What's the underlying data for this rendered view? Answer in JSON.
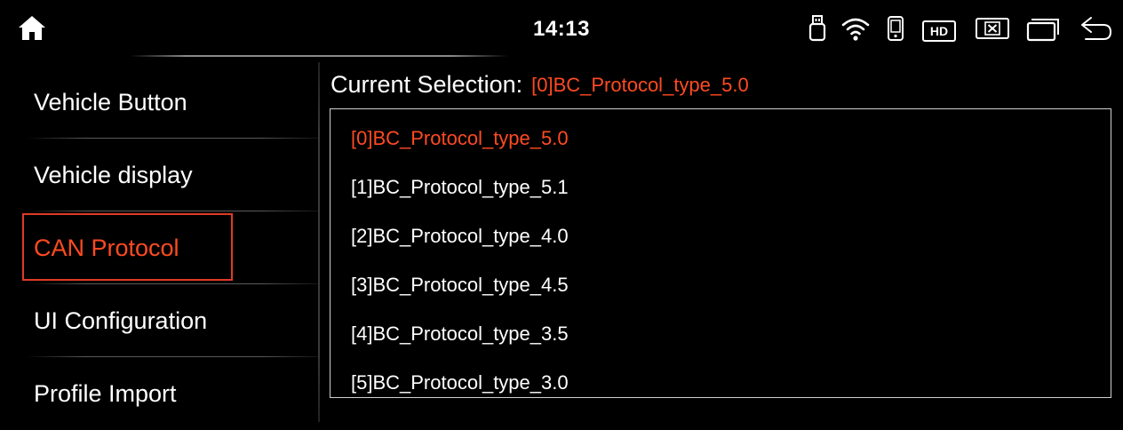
{
  "status_bar": {
    "time": "14:13",
    "hd_label": "HD",
    "icons": [
      "home-icon",
      "usb-icon",
      "wifi-icon",
      "phone-icon",
      "hd-icon",
      "close-window-icon",
      "window-icon",
      "back-icon"
    ]
  },
  "sidebar": {
    "items": [
      {
        "label": "Vehicle Button",
        "active": false
      },
      {
        "label": "Vehicle display",
        "active": false
      },
      {
        "label": "CAN Protocol",
        "active": true
      },
      {
        "label": "UI Configuration",
        "active": false
      },
      {
        "label": "Profile Import",
        "active": false
      }
    ]
  },
  "main": {
    "current_selection_label": "Current Selection:",
    "current_selection_value": "[0]BC_Protocol_type_5.0",
    "options": [
      {
        "label": "[0]BC_Protocol_type_5.0",
        "selected": true
      },
      {
        "label": "[1]BC_Protocol_type_5.1",
        "selected": false
      },
      {
        "label": "[2]BC_Protocol_type_4.0",
        "selected": false
      },
      {
        "label": "[3]BC_Protocol_type_4.5",
        "selected": false
      },
      {
        "label": "[4]BC_Protocol_type_3.5",
        "selected": false
      },
      {
        "label": "[5]BC_Protocol_type_3.0",
        "selected": false
      }
    ]
  },
  "colors": {
    "accent": "#ff4a22",
    "focus_border": "#e03a26",
    "background": "#000000",
    "text": "#ffffff"
  }
}
